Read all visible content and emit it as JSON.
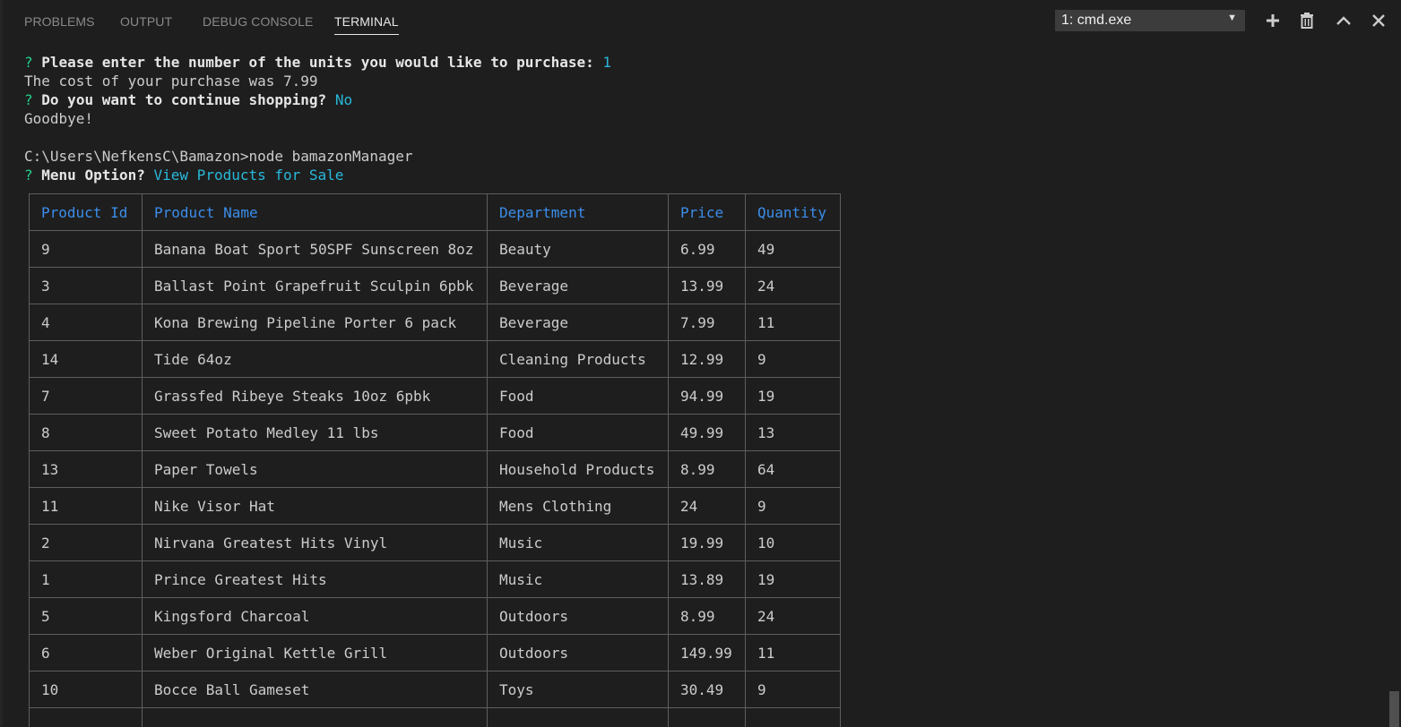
{
  "panel": {
    "tabs": [
      {
        "label": "PROBLEMS"
      },
      {
        "label": "OUTPUT"
      },
      {
        "label": "DEBUG CONSOLE"
      },
      {
        "label": "TERMINAL"
      }
    ],
    "active_tab": "TERMINAL",
    "terminal_select": {
      "value": "1: cmd.exe"
    },
    "actions": [
      "plus-icon",
      "trash-icon",
      "chevron-up-icon",
      "close-icon"
    ]
  },
  "terminal": {
    "q1": {
      "mark": "?",
      "prompt": "Please enter the number of the units you would like to purchase:",
      "answer": "1"
    },
    "cost_line": "The cost of your purchase was 7.99",
    "q2": {
      "mark": "?",
      "prompt": "Do you want to continue shopping?",
      "answer": "No"
    },
    "goodbye": "Goodbye!",
    "command": "C:\\Users\\NefkensC\\Bamazon>node bamazonManager",
    "q3": {
      "mark": "?",
      "prompt": "Menu Option?",
      "answer": "View Products for Sale"
    }
  },
  "table": {
    "headers": [
      "Product Id",
      "Product Name",
      "Department",
      "Price",
      "Quantity"
    ],
    "rows": [
      [
        "9",
        "Banana Boat Sport 50SPF Sunscreen 8oz",
        "Beauty",
        "6.99",
        "49"
      ],
      [
        "3",
        "Ballast Point Grapefruit Sculpin 6pbk",
        "Beverage",
        "13.99",
        "24"
      ],
      [
        "4",
        "Kona Brewing Pipeline Porter 6 pack",
        "Beverage",
        "7.99",
        "11"
      ],
      [
        "14",
        "Tide 64oz",
        "Cleaning Products",
        "12.99",
        "9"
      ],
      [
        "7",
        "Grassfed Ribeye Steaks 10oz 6pbk",
        "Food",
        "94.99",
        "19"
      ],
      [
        "8",
        "Sweet Potato Medley 11 lbs",
        "Food",
        "49.99",
        "13"
      ],
      [
        "13",
        "Paper Towels",
        "Household Products",
        "8.99",
        "64"
      ],
      [
        "11",
        "Nike Visor Hat",
        "Mens Clothing",
        "24",
        "9"
      ],
      [
        "2",
        "Nirvana Greatest Hits Vinyl",
        "Music",
        "19.99",
        "10"
      ],
      [
        "1",
        "Prince Greatest Hits",
        "Music",
        "13.89",
        "19"
      ],
      [
        "5",
        "Kingsford Charcoal",
        "Outdoors",
        "8.99",
        "24"
      ],
      [
        "6",
        "Weber Original Kettle Grill",
        "Outdoors",
        "149.99",
        "11"
      ],
      [
        "10",
        "Bocce Ball Gameset",
        "Toys",
        "30.49",
        "9"
      ],
      [
        "",
        "",
        "",
        "",
        ""
      ]
    ]
  }
}
